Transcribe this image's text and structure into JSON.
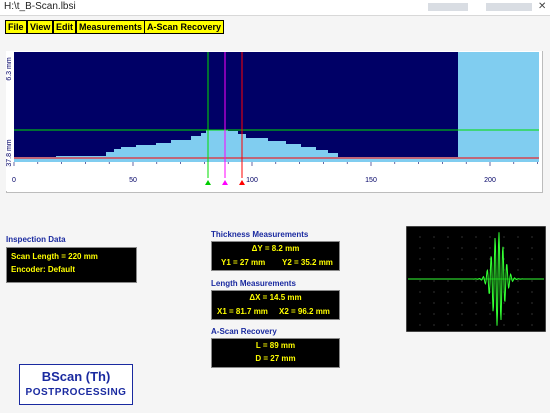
{
  "window": {
    "title": "H:\\t_B-Scan.lbsi"
  },
  "menu": [
    "File",
    "View",
    "Edit",
    "Measurements",
    "A-Scan Recovery"
  ],
  "bscan": {
    "y_tick_labels": [
      "6.3 mm",
      "37.8 mm"
    ],
    "x_tick_labels": [
      "0",
      "50",
      "100",
      "150",
      "200"
    ],
    "colors": {
      "background": "#000066",
      "profile": "#80cdf0",
      "cursor_green": "#00dd00",
      "cursor_magenta": "#ff00ff",
      "cursor_red": "#ff0000"
    }
  },
  "inspection": {
    "title": "Inspection Data",
    "scan_length": "Scan Length = 220 mm",
    "encoder": "Encoder: Default"
  },
  "thickness": {
    "title": "Thickness Measurements",
    "dy": "ΔY = 8.2 mm",
    "y1": "Y1 = 27 mm",
    "y2": "Y2 = 35.2 mm"
  },
  "length": {
    "title": "Length Measurements",
    "dx": "ΔX = 14.5 mm",
    "x1": "X1 = 81.7 mm",
    "x2": "X2 = 96.2 mm"
  },
  "ascan_recovery": {
    "title": "A-Scan Recovery",
    "l": "L = 89 mm",
    "d": "D = 27 mm"
  },
  "logo": {
    "line1": "BScan (Th)",
    "line2": "POSTPROCESSING"
  }
}
